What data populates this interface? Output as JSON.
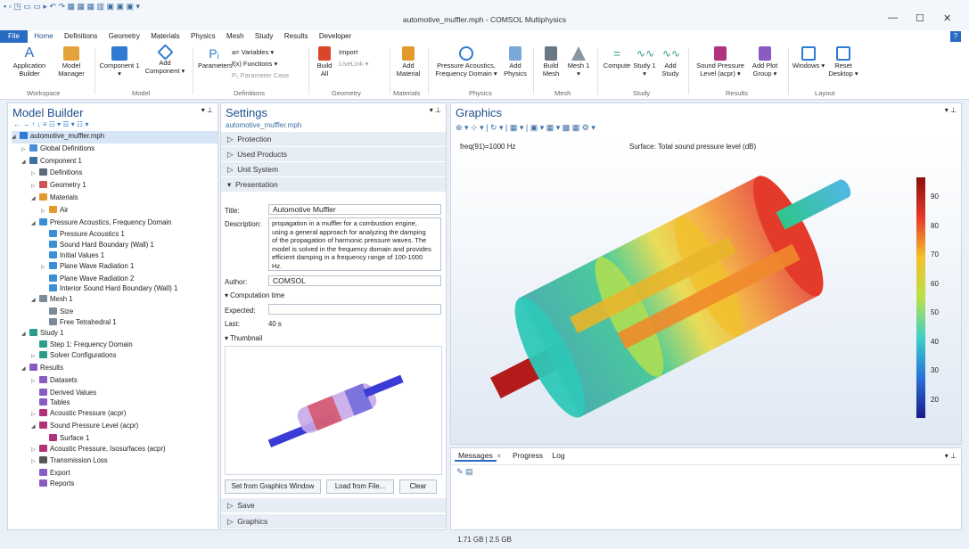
{
  "window": {
    "title": "automotive_muffler.mph - COMSOL Multiphysics",
    "minimize": "—",
    "maximize": "☐",
    "close": "✕"
  },
  "menu": [
    "File",
    "Home",
    "Definitions",
    "Geometry",
    "Materials",
    "Physics",
    "Mesh",
    "Study",
    "Results",
    "Developer"
  ],
  "help": "?",
  "ribbon": {
    "app_builder": "Application Builder",
    "model_manager": "Model Manager",
    "component": "Component 1 ▾",
    "add_component": "Add Component ▾",
    "parameters": "Parameters",
    "variables": "a= Variables ▾",
    "functions": "f(x) Functions ▾",
    "parameter_case": "P₁ Parameter Case",
    "build_all": "Build All",
    "import": "Import",
    "livelink": "LiveLink ▾",
    "add_material": "Add Material",
    "pressure_acoustics": "Pressure Acoustics, Frequency Domain ▾",
    "add_physics": "Add Physics",
    "build_mesh": "Build Mesh",
    "mesh1": "Mesh 1 ▾",
    "compute": "Compute",
    "study1": "Study 1 ▾",
    "add_study": "Add Study",
    "spl": "Sound Pressure Level (acpr) ▾",
    "add_plot_group": "Add Plot Group ▾",
    "windows": "Windows ▾",
    "reset_desktop": "Reset Desktop ▾",
    "groups": [
      "Workspace",
      "Model",
      "Definitions",
      "Geometry",
      "Materials",
      "Physics",
      "Mesh",
      "Study",
      "Results",
      "Layout"
    ]
  },
  "model_builder": {
    "title": "Model Builder",
    "toolbar": "← → ↑ ↓ ≡ ☷ ▾ ☰ ▾ ☷ ▾",
    "tree": [
      {
        "label": "automotive_muffler.mph",
        "d": 0,
        "c": "#2e7bd1",
        "a": "◢"
      },
      {
        "label": "Global Definitions",
        "d": 1,
        "c": "#4a90d9",
        "a": "▷"
      },
      {
        "label": "Component 1",
        "d": 1,
        "c": "#3a6ea5",
        "a": "◢"
      },
      {
        "label": "Definitions",
        "d": 2,
        "c": "#5b6b7b",
        "a": "▷"
      },
      {
        "label": "Geometry 1",
        "d": 2,
        "c": "#cc5555",
        "a": "▷"
      },
      {
        "label": "Materials",
        "d": 2,
        "c": "#e39a2d",
        "a": "◢"
      },
      {
        "label": "Air",
        "d": 3,
        "c": "#e39a2d",
        "a": "▷"
      },
      {
        "label": "Pressure Acoustics, Frequency Domain",
        "d": 2,
        "c": "#3a8fd6",
        "a": "◢"
      },
      {
        "label": "Pressure Acoustics 1",
        "d": 3,
        "c": "#3a8fd6",
        "a": ""
      },
      {
        "label": "Sound Hard Boundary (Wall) 1",
        "d": 3,
        "c": "#3a8fd6",
        "a": ""
      },
      {
        "label": "Initial Values 1",
        "d": 3,
        "c": "#3a8fd6",
        "a": ""
      },
      {
        "label": "Plane Wave Radiation 1",
        "d": 3,
        "c": "#3a8fd6",
        "a": "▷"
      },
      {
        "label": "Plane Wave Radiation 2",
        "d": 3,
        "c": "#3a8fd6",
        "a": ""
      },
      {
        "label": "Interior Sound Hard Boundary (Wall) 1",
        "d": 3,
        "c": "#3a8fd6",
        "a": ""
      },
      {
        "label": "Mesh 1",
        "d": 2,
        "c": "#7a8a9a",
        "a": "◢"
      },
      {
        "label": "Size",
        "d": 3,
        "c": "#7a8a9a",
        "a": ""
      },
      {
        "label": "Free Tetrahedral 1",
        "d": 3,
        "c": "#7a8a9a",
        "a": ""
      },
      {
        "label": "Study 1",
        "d": 1,
        "c": "#2b9c8a",
        "a": "◢"
      },
      {
        "label": "Step 1: Frequency Domain",
        "d": 2,
        "c": "#2b9c8a",
        "a": ""
      },
      {
        "label": "Solver Configurations",
        "d": 2,
        "c": "#2b9c8a",
        "a": "▷"
      },
      {
        "label": "Results",
        "d": 1,
        "c": "#8a5cc2",
        "a": "◢"
      },
      {
        "label": "Datasets",
        "d": 2,
        "c": "#8a5cc2",
        "a": "▷"
      },
      {
        "label": "Derived Values",
        "d": 2,
        "c": "#8a5cc2",
        "a": ""
      },
      {
        "label": "Tables",
        "d": 2,
        "c": "#8a5cc2",
        "a": ""
      },
      {
        "label": "Acoustic Pressure (acpr)",
        "d": 2,
        "c": "#b0327a",
        "a": "▷"
      },
      {
        "label": "Sound Pressure Level (acpr)",
        "d": 2,
        "c": "#b0327a",
        "a": "◢"
      },
      {
        "label": "Surface 1",
        "d": 3,
        "c": "#b0327a",
        "a": ""
      },
      {
        "label": "Acoustic Pressure, Isosurfaces (acpr)",
        "d": 2,
        "c": "#b0327a",
        "a": "▷"
      },
      {
        "label": "Transmission Loss",
        "d": 2,
        "c": "#555",
        "a": "▷"
      },
      {
        "label": "Export",
        "d": 2,
        "c": "#8a5cc2",
        "a": ""
      },
      {
        "label": "Reports",
        "d": 2,
        "c": "#8a5cc2",
        "a": ""
      }
    ]
  },
  "settings": {
    "title": "Settings",
    "subtitle": "automotive_muffler.mph",
    "sections": [
      "Protection",
      "Used Products",
      "Unit System",
      "Presentation"
    ],
    "title_label": "Title:",
    "title_value": "Automotive Muffler",
    "desc_label": "Description:",
    "desc_value": "propagation in a muffler for a combustion engine, using a general approach for analyzing the damping of the propagation of harmonic pressure waves. The model is solved in the frequency domain and provides efficient damping in a frequency range of 100-1000 Hz.",
    "author_label": "Author:",
    "author_value": "COMSOL",
    "comp_time": "Computation time",
    "expected_label": "Expected:",
    "last_label": "Last:",
    "last_value": "40 s",
    "thumbnail": "Thumbnail",
    "btn_set": "Set from Graphics Window",
    "btn_load": "Load from File...",
    "btn_clear": "Clear",
    "save": "Save",
    "graphics": "Graphics"
  },
  "graphics": {
    "title": "Graphics",
    "freq": "freq(91)=1000 Hz",
    "surface": "Surface: Total sound pressure level (dB)",
    "colorbar_ticks": [
      "90",
      "80",
      "70",
      "60",
      "50",
      "40",
      "30",
      "20"
    ]
  },
  "messages": {
    "tabs": [
      "Messages",
      "Progress",
      "Log"
    ]
  },
  "status": "1.71 GB | 2.5 GB"
}
